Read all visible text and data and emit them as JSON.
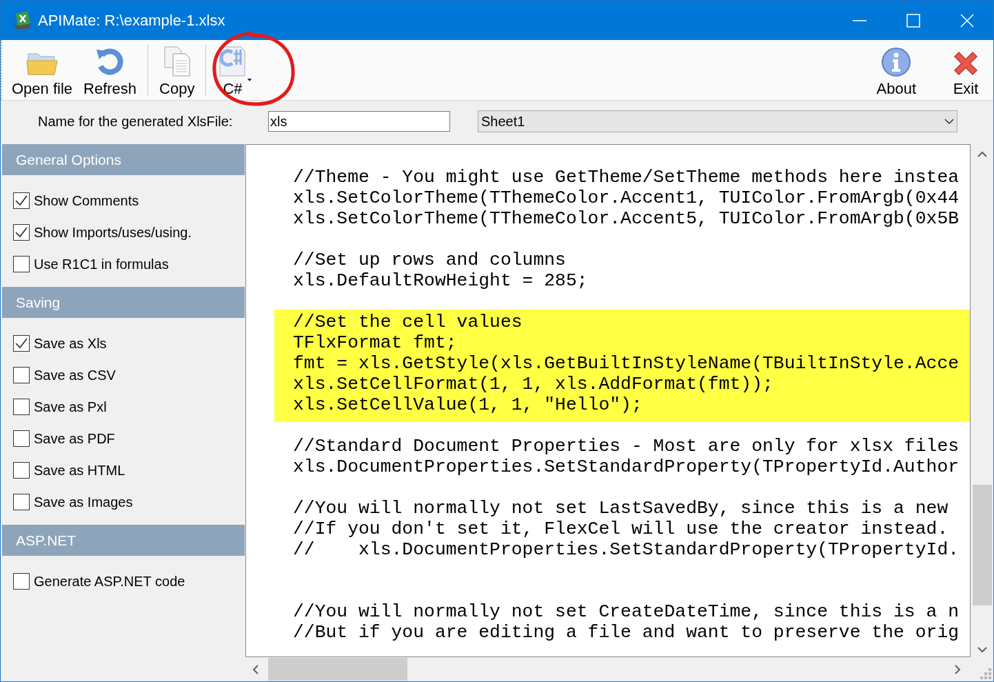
{
  "window": {
    "title": "APIMate: R:\\example-1.xlsx"
  },
  "toolbar": {
    "groups": [
      [
        {
          "label": "Open file",
          "kind": "button"
        },
        {
          "label": "Refresh",
          "kind": "button"
        }
      ],
      [
        {
          "label": "Copy",
          "kind": "button"
        }
      ],
      [
        {
          "label": "C#",
          "kind": "dropdown"
        }
      ]
    ],
    "right_items": [
      {
        "label": "About",
        "kind": "button"
      },
      {
        "label": "Exit",
        "kind": "button"
      }
    ]
  },
  "name_row": {
    "label": "Name for the generated XlsFile:",
    "value": "xls"
  },
  "sheet_select": {
    "value": "Sheet1"
  },
  "sections": [
    {
      "title": "General Options",
      "options": [
        {
          "label": "Show Comments",
          "checked": true
        },
        {
          "label": "Show Imports/uses/using.",
          "checked": true
        },
        {
          "label": "Use R1C1 in formulas",
          "checked": false
        }
      ]
    },
    {
      "title": "Saving",
      "options": [
        {
          "label": "Save as Xls",
          "checked": true
        },
        {
          "label": "Save as CSV",
          "checked": false
        },
        {
          "label": "Save as Pxl",
          "checked": false
        },
        {
          "label": "Save as PDF",
          "checked": false
        },
        {
          "label": "Save as HTML",
          "checked": false
        },
        {
          "label": "Save as Images",
          "checked": false
        }
      ]
    },
    {
      "title": "ASP.NET",
      "options": [
        {
          "label": "Generate ASP.NET code",
          "checked": false
        }
      ]
    }
  ],
  "code": {
    "lines": [
      {
        "kind": "text",
        "text": "//Theme - You might use GetTheme/SetTheme methods here instea",
        "highlighted": false
      },
      {
        "kind": "text",
        "text": "xls.SetColorTheme(TThemeColor.Accent1, TUIColor.FromArgb(0x44",
        "highlighted": false
      },
      {
        "kind": "text",
        "text": "xls.SetColorTheme(TThemeColor.Accent5, TUIColor.FromArgb(0x5B",
        "highlighted": false
      },
      {
        "kind": "blank",
        "highlighted": false
      },
      {
        "kind": "text",
        "text": "//Set up rows and columns",
        "highlighted": false
      },
      {
        "kind": "text",
        "text": "xls.DefaultRowHeight = 285;",
        "highlighted": false
      },
      {
        "kind": "blank",
        "highlighted": false
      },
      {
        "kind": "text",
        "text": "//Set the cell values",
        "highlighted": true
      },
      {
        "kind": "text",
        "text": "TFlxFormat fmt;",
        "highlighted": true
      },
      {
        "kind": "text",
        "text": "fmt = xls.GetStyle(xls.GetBuiltInStyleName(TBuiltInStyle.Acce",
        "highlighted": true
      },
      {
        "kind": "text",
        "text": "xls.SetCellFormat(1, 1, xls.AddFormat(fmt));",
        "highlighted": true
      },
      {
        "kind": "text",
        "text": "xls.SetCellValue(1, 1, \"Hello\");",
        "highlighted": true
      },
      {
        "kind": "blank",
        "highlighted": false
      },
      {
        "kind": "text",
        "text": "//Standard Document Properties - Most are only for xlsx files",
        "highlighted": false
      },
      {
        "kind": "text",
        "text": "xls.DocumentProperties.SetStandardProperty(TPropertyId.Author",
        "highlighted": false
      },
      {
        "kind": "blank",
        "highlighted": false
      },
      {
        "kind": "text",
        "text": "//You will normally not set LastSavedBy, since this is a new",
        "highlighted": false
      },
      {
        "kind": "text",
        "text": "//If you don't set it, FlexCel will use the creator instead.",
        "highlighted": false
      },
      {
        "kind": "text",
        "text": "//    xls.DocumentProperties.SetStandardProperty(TPropertyId.",
        "highlighted": false
      },
      {
        "kind": "blank",
        "highlighted": false
      },
      {
        "kind": "blank",
        "highlighted": false
      },
      {
        "kind": "text",
        "text": "//You will normally not set CreateDateTime, since this is a n",
        "highlighted": false
      },
      {
        "kind": "text",
        "text": "//But if you are editing a file and want to preserve the orig",
        "highlighted": false
      }
    ]
  }
}
